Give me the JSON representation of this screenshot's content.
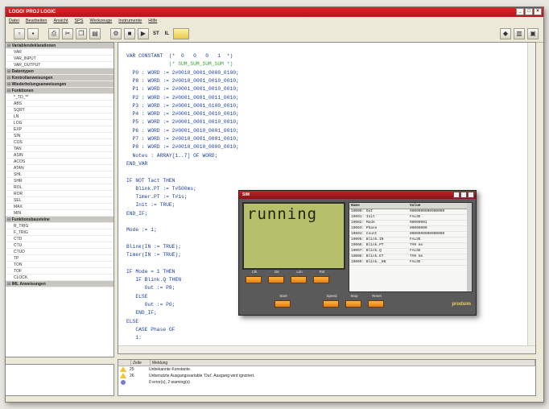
{
  "window": {
    "title": "LOGO! PROJ LOGIC",
    "controls": [
      "_",
      "□",
      "×"
    ]
  },
  "menu": [
    "Datei",
    "Bearbeiten",
    "Ansicht",
    "SPS",
    "Werkzeuge",
    "Instrumente",
    "Hilfe"
  ],
  "toolbar": {
    "buttons": [
      "new-icon",
      "save-icon",
      "print-icon",
      "cut-icon",
      "copy-icon",
      "paste-icon",
      "gear-icon",
      "stop-icon",
      "play-icon"
    ],
    "st_label": "ST",
    "il_label": "IL"
  },
  "tree": [
    {
      "label": "Variablendeklarationen",
      "group": true
    },
    {
      "label": "VAR",
      "group": false
    },
    {
      "label": "VAR_INPUT",
      "group": false
    },
    {
      "label": "VAR_OUTPUT",
      "group": false
    },
    {
      "label": "Datentypen",
      "group": true
    },
    {
      "label": "Kontrollanweisungen",
      "group": true
    },
    {
      "label": "Wiederholungsanweisungen",
      "group": true
    },
    {
      "label": "Funktionen",
      "group": true
    },
    {
      "label": "*_TO_**",
      "group": false
    },
    {
      "label": "ABS",
      "group": false
    },
    {
      "label": "SQRT",
      "group": false
    },
    {
      "label": "LN",
      "group": false
    },
    {
      "label": "LOG",
      "group": false
    },
    {
      "label": "EXP",
      "group": false
    },
    {
      "label": "SIN",
      "group": false
    },
    {
      "label": "COS",
      "group": false
    },
    {
      "label": "TAN",
      "group": false
    },
    {
      "label": "ASIN",
      "group": false
    },
    {
      "label": "ACOS",
      "group": false
    },
    {
      "label": "ATAN",
      "group": false
    },
    {
      "label": "SHL",
      "group": false
    },
    {
      "label": "SHR",
      "group": false
    },
    {
      "label": "ROL",
      "group": false
    },
    {
      "label": "ROR",
      "group": false
    },
    {
      "label": "SEL",
      "group": false
    },
    {
      "label": "MAX",
      "group": false
    },
    {
      "label": "MIN",
      "group": false
    },
    {
      "label": "Funktionsbausteine",
      "group": true
    },
    {
      "label": "R_TRIG",
      "group": false
    },
    {
      "label": "F_TRIG",
      "group": false
    },
    {
      "label": "CTD",
      "group": false
    },
    {
      "label": "CTU",
      "group": false
    },
    {
      "label": "CTUD",
      "group": false
    },
    {
      "label": "TP",
      "group": false
    },
    {
      "label": "TON",
      "group": false
    },
    {
      "label": "TOF",
      "group": false
    },
    {
      "label": "CLOCK",
      "group": false
    },
    {
      "label": "IML Anweisungen",
      "group": true
    }
  ],
  "code": [
    {
      "text": "VAR CONSTANT  (*  0   0   0   1  *)",
      "kind": "k"
    },
    {
      "text": "              (* SUM_SUM_SUM_SUM *)",
      "kind": "c"
    },
    {
      "text": "  P0 : WORD := 2#0010_0001_0000_0100;",
      "kind": ""
    },
    {
      "text": "  P8 : WORD := 2#0010_0001_0010_0010;",
      "kind": ""
    },
    {
      "text": "  P1 : WORD := 2#0001_0001_0010_0010;",
      "kind": ""
    },
    {
      "text": "  P2 : WORD := 2#0001_0001_0011_0010;",
      "kind": ""
    },
    {
      "text": "  P3 : WORD := 2#0001_0001_0100_0010;",
      "kind": ""
    },
    {
      "text": "  P4 : WORD := 2#0001_0001_0010_0010;",
      "kind": ""
    },
    {
      "text": "  P5 : WORD := 2#0001_0001_0010_0010;",
      "kind": ""
    },
    {
      "text": "  P6 : WORD := 2#0001_0010_0001_0010;",
      "kind": ""
    },
    {
      "text": "  P7 : WORD := 2#0010_0001_0001_0010;",
      "kind": ""
    },
    {
      "text": "  P8 : WORD := 2#0010_0010_0000_0010;",
      "kind": ""
    },
    {
      "text": "  Notes : ARRAY[1..7] OF WORD;",
      "kind": ""
    },
    {
      "text": "END_VAR",
      "kind": "k"
    },
    {
      "text": "",
      "kind": ""
    },
    {
      "text": "IF NOT Tact THEN",
      "kind": "k"
    },
    {
      "text": "   Blink.PT := T#500ms;",
      "kind": ""
    },
    {
      "text": "   Timer.PT := T#1s;",
      "kind": ""
    },
    {
      "text": "   Init := TRUE;",
      "kind": ""
    },
    {
      "text": "END_IF;",
      "kind": "k"
    },
    {
      "text": "",
      "kind": ""
    },
    {
      "text": "Mode := 1;",
      "kind": ""
    },
    {
      "text": "",
      "kind": ""
    },
    {
      "text": "Blink(IN := TRUE);",
      "kind": ""
    },
    {
      "text": "Timer(IN := TRUE);",
      "kind": ""
    },
    {
      "text": "",
      "kind": ""
    },
    {
      "text": "IF Mode = 1 THEN",
      "kind": "k"
    },
    {
      "text": "   IF Blink.Q THEN",
      "kind": "k"
    },
    {
      "text": "      Out := P8;",
      "kind": ""
    },
    {
      "text": "   ELSE",
      "kind": "k"
    },
    {
      "text": "      Out := P0;",
      "kind": ""
    },
    {
      "text": "   END_IF;",
      "kind": "k"
    },
    {
      "text": "ELSE",
      "kind": "k"
    },
    {
      "text": "   CASE Phase OF",
      "kind": "k"
    },
    {
      "text": "   1:",
      "kind": ""
    }
  ],
  "simulator": {
    "title": "SIM",
    "lcd_text": "running",
    "var_headers": [
      "Name",
      "Value"
    ],
    "vars": [
      [
        "10000: Out",
        "0000000000000000"
      ],
      [
        "10001: Init",
        "FALSE"
      ],
      [
        "10002: Mode",
        "00000001"
      ],
      [
        "10003: Phase",
        "00000000"
      ],
      [
        "10004: Count",
        "0000000000000000"
      ],
      [
        "10005: Blink.IN",
        "FALSE"
      ],
      [
        "10006: Blink.PT",
        "T#0 ms"
      ],
      [
        "10007: Blink.Q",
        "FALSE"
      ],
      [
        "10008: Blink.ET",
        "T#0 ms"
      ],
      [
        "10009: Blink._HB",
        "FALSE"
      ]
    ],
    "row1_labels": [
      "Clk",
      "Dir",
      "Lim",
      "Rst"
    ],
    "row2_labels": [
      "Start",
      "Speed",
      "Stop",
      "Reset"
    ],
    "brand": "prodsim"
  },
  "messages": {
    "headers": [
      "Zeile",
      "Meldung"
    ],
    "rows": [
      {
        "icon": "warning-icon",
        "line": "25",
        "text": "Unbekannte Konstante."
      },
      {
        "icon": "warning-icon",
        "line": "26",
        "text": "Unbenutzte Ausgangsvariable 'Out'. Ausgang wird ignoriert."
      },
      {
        "icon": "info-icon",
        "line": "",
        "text": "0 error(s), 2 warning(s)"
      }
    ]
  },
  "colors": {
    "title_red": "#c01c21",
    "lcd_green": "#b6c06a",
    "sim_button": "#f29b2c",
    "code_blue": "#1d3f9a",
    "comment_green": "#3aa33a"
  }
}
